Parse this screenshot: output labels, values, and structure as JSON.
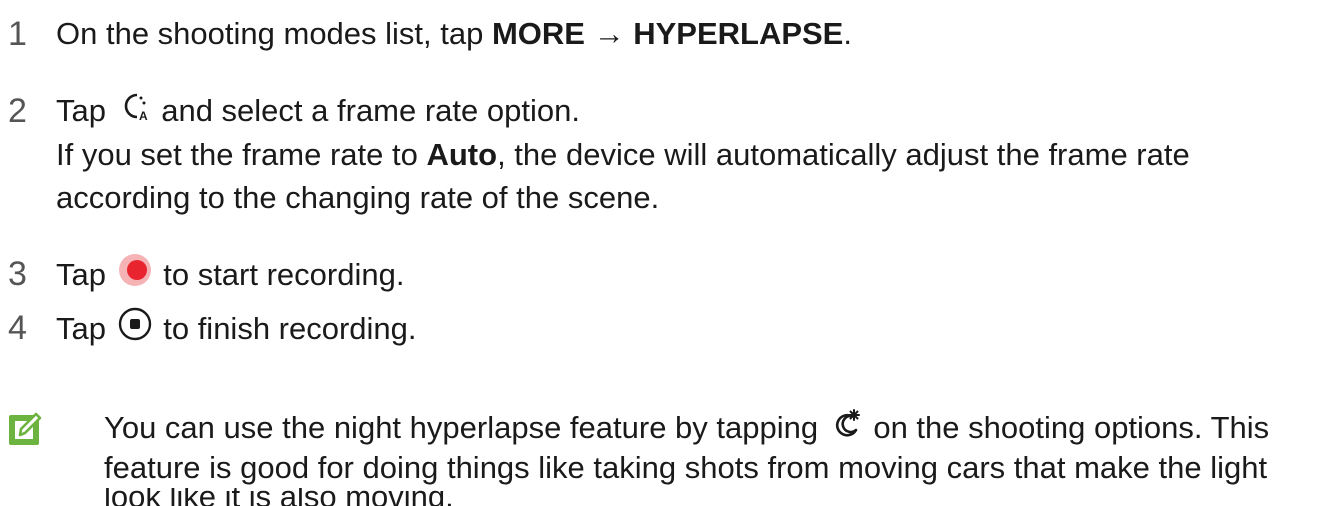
{
  "steps": [
    {
      "num": "1",
      "pre": "On the shooting modes list, tap ",
      "b1": "MORE",
      "arrow": " → ",
      "b2": "HYPERLAPSE",
      "post": "."
    },
    {
      "num": "2",
      "pre": "Tap ",
      "icon": "frame-rate-auto-icon",
      "post": " and select a frame rate option.",
      "cont1_pre": "If you set the frame rate to ",
      "cont1_b": "Auto",
      "cont1_post": ", the device will automatically adjust the frame rate",
      "cont2": "according to the changing rate of the scene."
    },
    {
      "num": "3",
      "pre": "Tap ",
      "icon": "record-button-icon",
      "post": " to start recording."
    },
    {
      "num": "4",
      "pre": "Tap ",
      "icon": "stop-button-icon",
      "post": " to finish recording."
    }
  ],
  "note": {
    "icon": "note-pencil-icon",
    "line1_pre": "You can use the night hyperlapse feature by tapping ",
    "line1_icon": "night-hyperlapse-icon",
    "line1_post": " on the shooting options. This",
    "line2": "feature is good for doing things like taking shots from moving cars that make the light",
    "line3": "look like it is also moving."
  },
  "colors": {
    "text": "#1a1a1a",
    "step_number": "#555555",
    "note_icon": "#6cb33f",
    "record_red": "#e8252f"
  }
}
